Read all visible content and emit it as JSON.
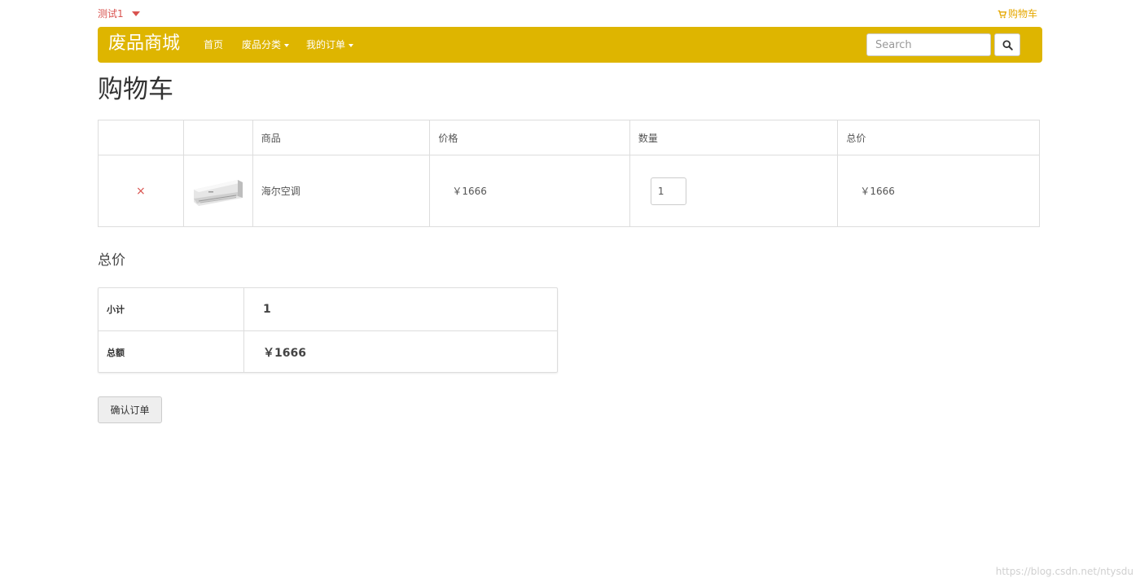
{
  "topbar": {
    "user_label": "测试1",
    "cart_label": "购物车"
  },
  "navbar": {
    "brand": "废品商城",
    "items": [
      {
        "label": "首页"
      },
      {
        "label": "废品分类"
      },
      {
        "label": "我的订单"
      }
    ],
    "search_placeholder": "Search"
  },
  "page": {
    "title": "购物车"
  },
  "cart_table": {
    "headers": [
      "",
      "",
      "商品",
      "价格",
      "数量",
      "总价"
    ],
    "rows": [
      {
        "remove": "×",
        "product": "海尔空调",
        "price": "￥1666",
        "quantity": "1",
        "total": "￥1666"
      }
    ]
  },
  "summary": {
    "heading": "总价",
    "subtotal_label": "小计",
    "subtotal_value": "1",
    "total_label": "总额",
    "total_value": "￥1666"
  },
  "actions": {
    "confirm_label": "确认订单"
  },
  "watermark": "https://blog.csdn.net/ntysdu",
  "colors": {
    "navbar_bg": "#deb500",
    "user_link": "#d9534f",
    "cart_link": "#e6a800"
  },
  "icons": {
    "cart": "cart-icon",
    "search": "search-icon",
    "caret": "caret-down-icon",
    "remove": "close-icon"
  }
}
